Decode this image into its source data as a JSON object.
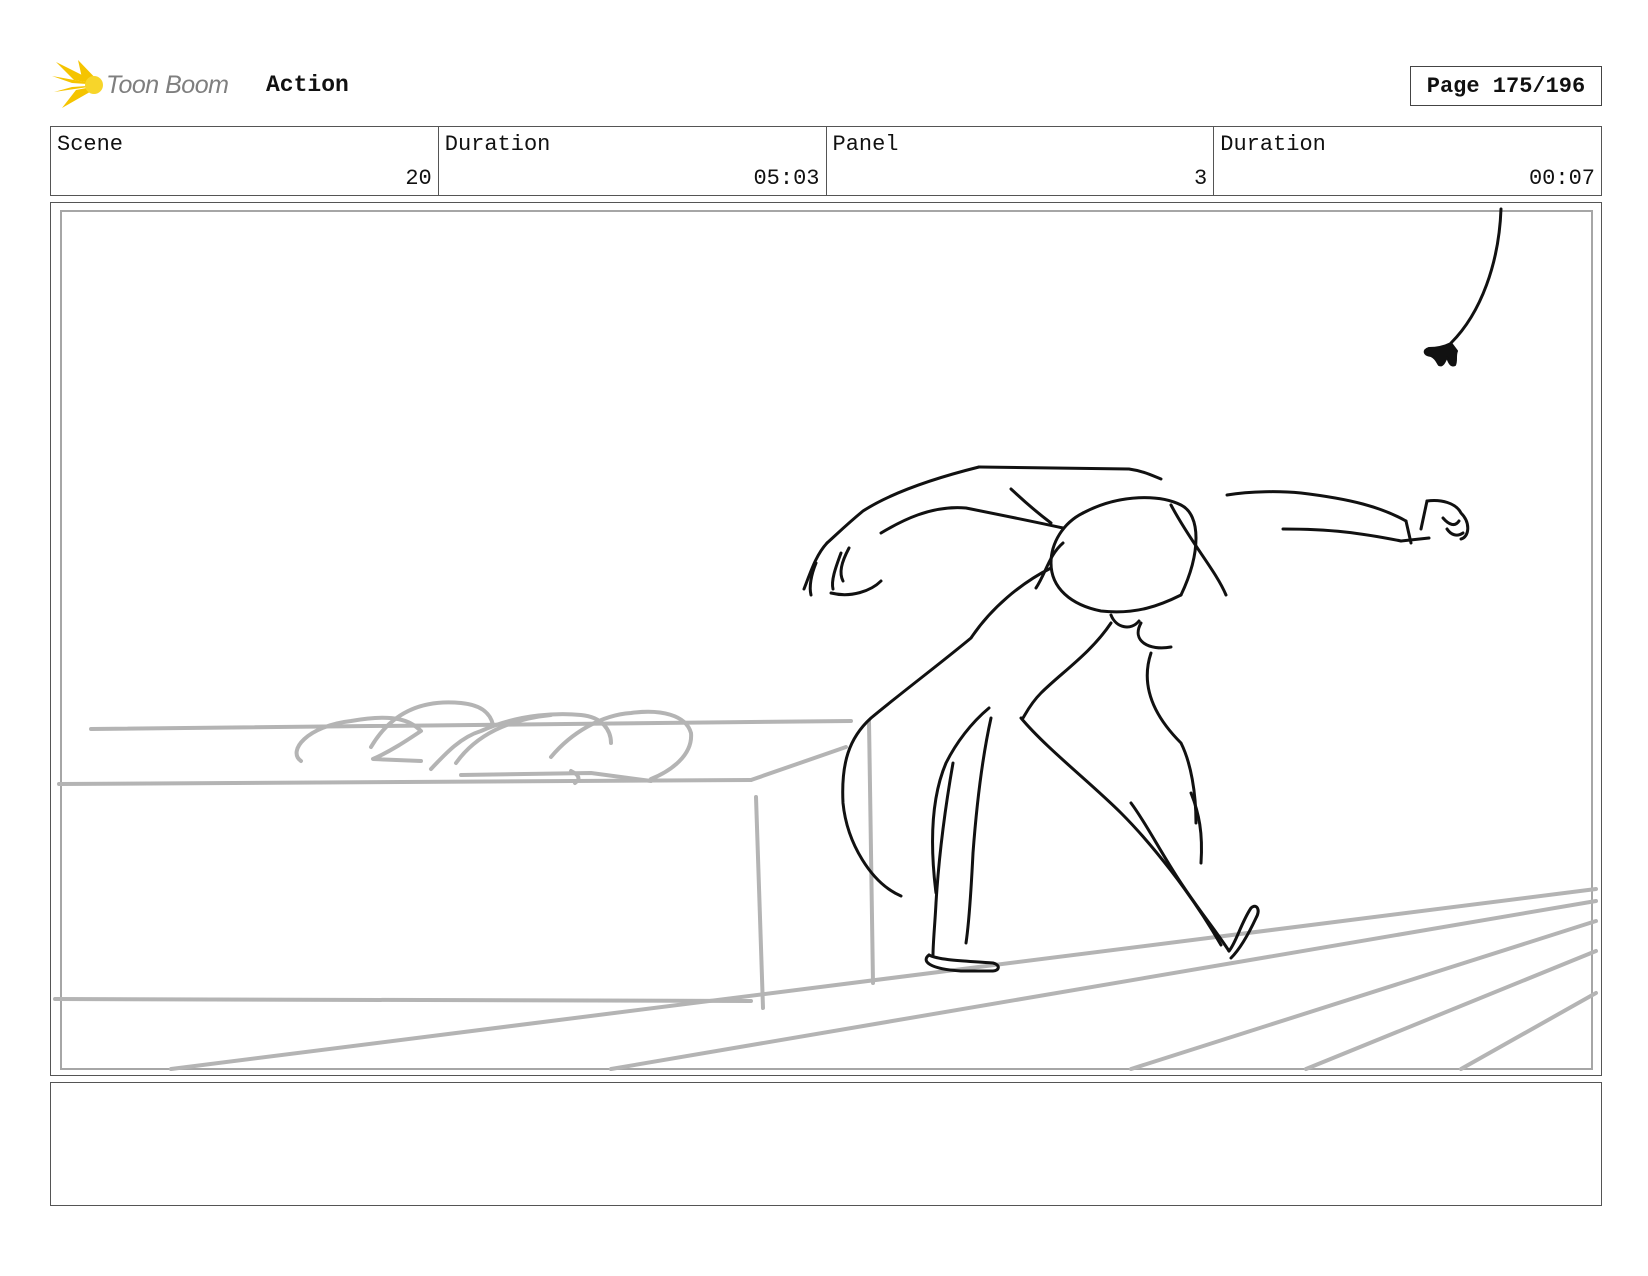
{
  "header": {
    "brand": "Toon Boom",
    "doc_type": "Action",
    "page_label": "Page 175/196"
  },
  "info": {
    "scene_label": "Scene",
    "scene_value": "20",
    "scene_duration_label": "Duration",
    "scene_duration_value": "05:03",
    "panel_label": "Panel",
    "panel_value": "3",
    "panel_duration_label": "Duration",
    "panel_duration_value": "00:07"
  },
  "notes": {
    "text": ""
  },
  "colors": {
    "logo_yellow": "#f5c400",
    "brand_gray": "#7f7f7f",
    "sketch_black": "#111111",
    "sketch_gray": "#b4b4b4"
  }
}
